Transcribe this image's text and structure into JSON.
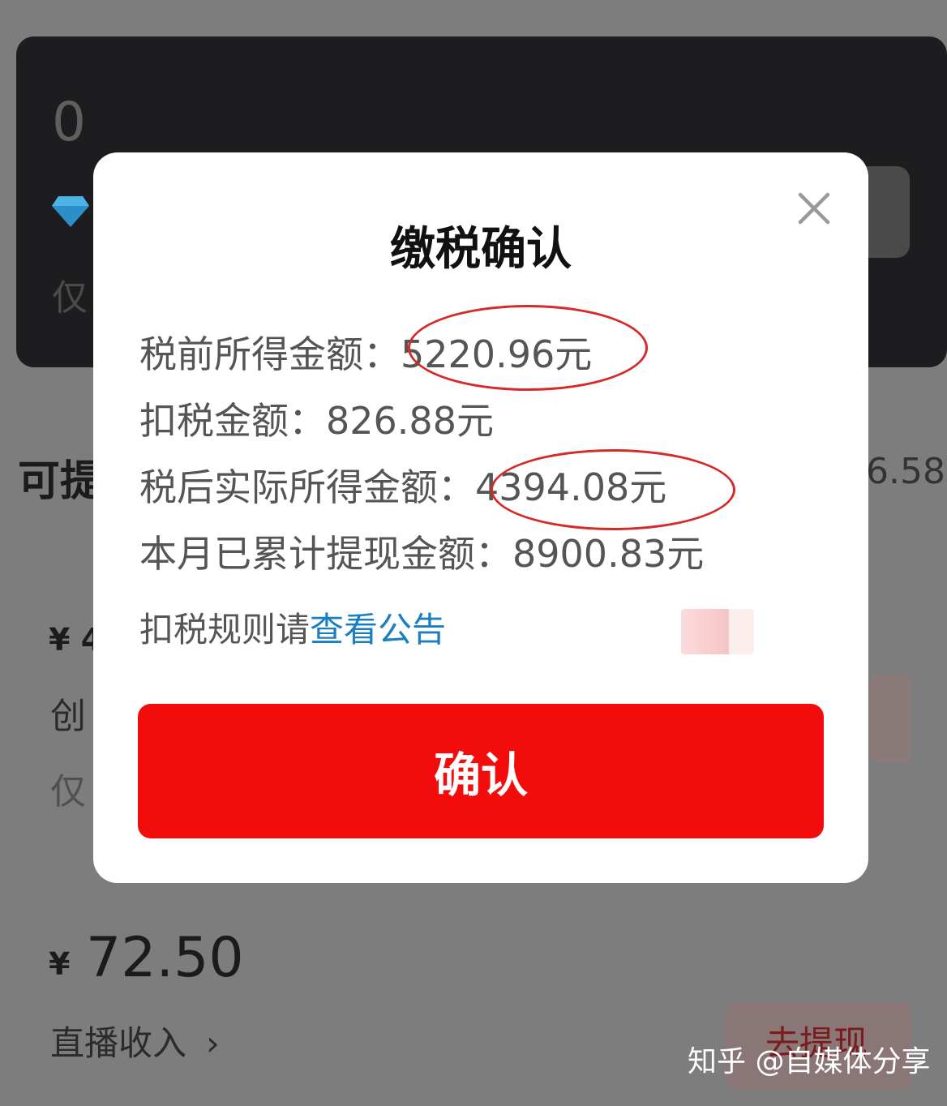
{
  "background": {
    "balance_value": "0",
    "only_text": "仅",
    "withdrawable_prefix": "可提",
    "right_amount_partial": "6.58",
    "currency_symbol": "¥",
    "amount_partial": "4",
    "creator_partial": "创",
    "only_text_2": "仅",
    "amount_2": "72.50",
    "live_income_label": "直播收入",
    "chevron": "›",
    "withdraw_button_label": "去提现"
  },
  "modal": {
    "title": "缴税确认",
    "pre_tax_label": "税前所得金额：",
    "pre_tax_value": "5220.96元",
    "tax_label": "扣税金额：",
    "tax_value": "826.88元",
    "after_tax_label": "税后实际所得金额：",
    "after_tax_value": "4394.08元",
    "monthly_label": "本月已累计提现金额：",
    "monthly_value": "8900.83元",
    "rule_prefix": "扣税规则请",
    "rule_link": "查看公告",
    "confirm_label": "确认"
  },
  "watermark": "知乎 @自媒体分享",
  "colors": {
    "confirm_button": "#f20c0c",
    "link": "#1a7fc2",
    "highlight_circle": "#d42a2a"
  }
}
